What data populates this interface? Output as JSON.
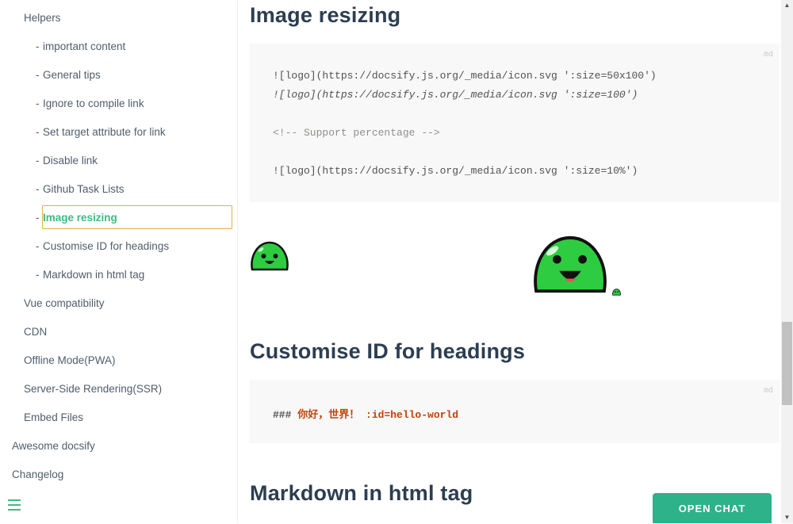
{
  "sidebar": {
    "helpers": "Helpers",
    "items": [
      {
        "label": "important content"
      },
      {
        "label": "General tips"
      },
      {
        "label": "Ignore to compile link"
      },
      {
        "label": "Set target attribute for link"
      },
      {
        "label": "Disable link"
      },
      {
        "label": "Github Task Lists"
      },
      {
        "label": "Image resizing"
      },
      {
        "label": "Customise ID for headings"
      },
      {
        "label": "Markdown in html tag"
      }
    ],
    "dash": "-",
    "lvl2": [
      {
        "label": "Vue compatibility"
      },
      {
        "label": "CDN"
      },
      {
        "label": "Offline Mode(PWA)"
      },
      {
        "label": "Server-Side Rendering(SSR)"
      },
      {
        "label": "Embed Files"
      }
    ],
    "lvl1": [
      {
        "label": "Awesome docsify"
      },
      {
        "label": "Changelog"
      }
    ]
  },
  "main": {
    "h_image_resizing": "Image resizing",
    "code1": {
      "lang": "md",
      "line1": "![logo](https://docsify.js.org/_media/icon.svg ':size=50x100')",
      "line2": "![logo](https://docsify.js.org/_media/icon.svg ':size=100')",
      "line3": "<!-- Support percentage -->",
      "line4": "![logo](https://docsify.js.org/_media/icon.svg ':size=10%')"
    },
    "h_customise": "Customise ID for headings",
    "code2": {
      "lang": "md",
      "prefix": "### ",
      "text": "你好，世界！ :id=hello-world"
    },
    "h_markdown": "Markdown in html tag"
  },
  "chat": {
    "label": "OPEN CHAT"
  },
  "colors": {
    "accent": "#42b983",
    "chat": "#2db28a"
  }
}
